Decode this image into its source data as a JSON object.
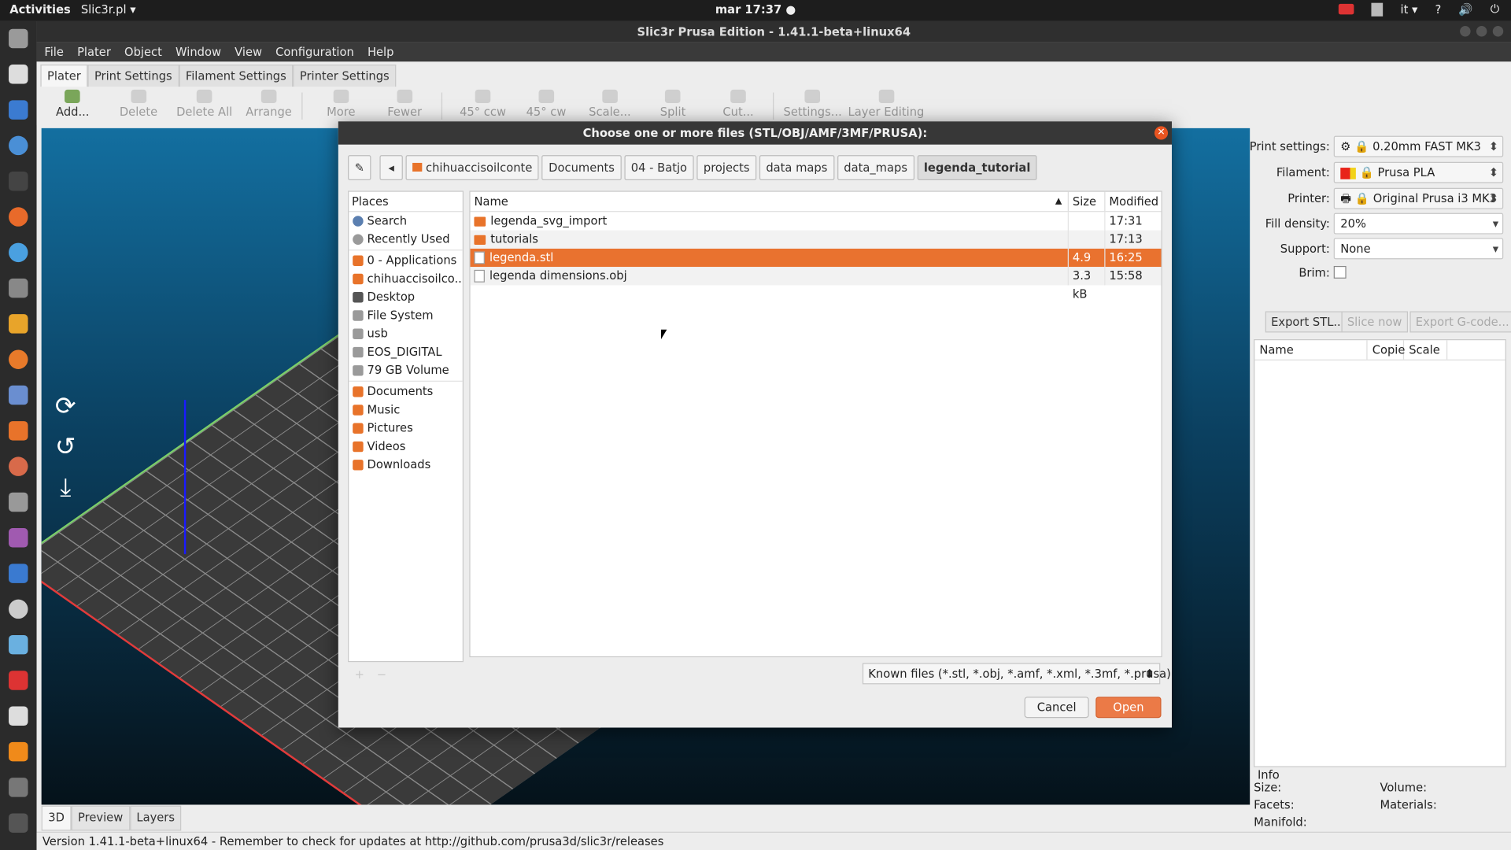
{
  "topbar": {
    "activities": "Activities",
    "app_menu": "Slic3r.pl ▾",
    "clock": "mar 17:37 ●",
    "keyboard_layout": "it ▾"
  },
  "window": {
    "title": "Slic3r Prusa Edition - 1.41.1-beta+linux64"
  },
  "menubar": [
    "File",
    "Plater",
    "Object",
    "Window",
    "View",
    "Configuration",
    "Help"
  ],
  "tabs": [
    "Plater",
    "Print Settings",
    "Filament Settings",
    "Printer Settings"
  ],
  "toolbar": {
    "add": "Add...",
    "delete": "Delete",
    "delete_all": "Delete All",
    "arrange": "Arrange",
    "more": "More",
    "fewer": "Fewer",
    "ccw": "45° ccw",
    "cw": "45° cw",
    "scale": "Scale...",
    "split": "Split",
    "cut": "Cut...",
    "settings": "Settings...",
    "layer_editing": "Layer Editing"
  },
  "canvas_tabs": [
    "3D",
    "Preview",
    "Layers"
  ],
  "right_panel": {
    "print_settings_label": "Print settings:",
    "print_settings_value": "0.20mm FAST MK3",
    "filament_label": "Filament:",
    "filament_value": "Prusa PLA",
    "filament_color": "#e8231a",
    "printer_label": "Printer:",
    "printer_value": "Original Prusa i3 MK3",
    "fill_density_label": "Fill density:",
    "fill_density_value": "20%",
    "support_label": "Support:",
    "support_value": "None",
    "brim_label": "Brim:",
    "export_stl": "Export STL...",
    "slice_now": "Slice now",
    "export_gcode": "Export G-code...",
    "list_headers": [
      "Name",
      "Copie",
      "Scale"
    ],
    "info_title": "Info",
    "info": {
      "size": "Size:",
      "volume": "Volume:",
      "facets": "Facets:",
      "materials": "Materials:",
      "manifold": "Manifold:"
    }
  },
  "statusbar": "Version 1.41.1-beta+linux64 - Remember to check for updates at http://github.com/prusa3d/slic3r/releases",
  "dialog": {
    "title": "Choose one or more files (STL/OBJ/AMF/3MF/PRUSA):",
    "breadcrumbs": [
      "chihuaccisoilconte",
      "Documents",
      "04 - Batjo",
      "projects",
      "data maps",
      "data_maps",
      "legenda_tutorial"
    ],
    "places_header": "Places",
    "places": [
      "Search",
      "Recently Used",
      "0 - Applications",
      "chihuaccisoilco...",
      "Desktop",
      "File System",
      "usb",
      "EOS_DIGITAL",
      "79 GB Volume",
      "Documents",
      "Music",
      "Pictures",
      "Videos",
      "Downloads"
    ],
    "columns": {
      "name": "Name",
      "size": "Size",
      "modified": "Modified"
    },
    "files": [
      {
        "name": "legenda_svg_import",
        "size": "",
        "modified": "17:31",
        "kind": "folder"
      },
      {
        "name": "tutorials",
        "size": "",
        "modified": "17:13",
        "kind": "folder"
      },
      {
        "name": "legenda.stl",
        "size": "4.9 kB",
        "modified": "16:25",
        "kind": "file"
      },
      {
        "name": "legenda dimensions.obj",
        "size": "3.3 kB",
        "modified": "15:58",
        "kind": "file"
      }
    ],
    "selected_index": 2,
    "filter": "Known files (*.stl, *.obj, *.amf, *.xml, *.3mf, *.prusa)",
    "cancel": "Cancel",
    "open": "Open",
    "accent_color": "#e9722f"
  }
}
